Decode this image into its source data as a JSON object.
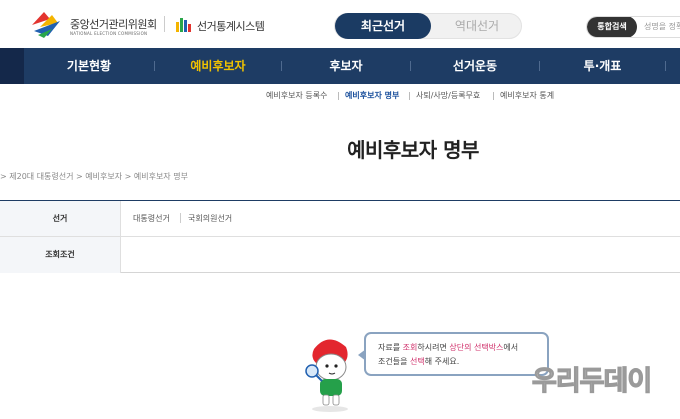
{
  "header": {
    "org_name": "중앙선거관리위원회",
    "org_english": "NATIONAL ELECTION COMMISSION",
    "system_name": "선거통계시스템",
    "toggle": {
      "active_label": "최근선거",
      "inactive_label": "역대선거"
    },
    "search": {
      "button_label": "통합검색",
      "placeholder": "성명을 정확"
    }
  },
  "gnb": {
    "items": [
      {
        "label": "기본현황"
      },
      {
        "label": "예비후보자"
      },
      {
        "label": "후보자"
      },
      {
        "label": "선거운동"
      },
      {
        "label": "투·개표"
      }
    ],
    "active_index": 1,
    "colors": {
      "bar": "#1e3c64",
      "active_text": "#f2c300"
    }
  },
  "subnav": {
    "items": [
      {
        "label": "예비후보자 등록수"
      },
      {
        "label": "예비후보자 명부"
      },
      {
        "label": "사퇴/사망/등록무효"
      },
      {
        "label": "예비후보자 통계"
      }
    ],
    "active_index": 1
  },
  "page": {
    "title": "예비후보자 명부",
    "breadcrumb": "> 제20대 대통령선거  >  예비후보자  >  예비후보자 명부"
  },
  "form": {
    "election_label": "선거",
    "election_options": [
      "대통령선거",
      "국회의원선거"
    ],
    "condition_label": "조회조건"
  },
  "guide": {
    "line1": {
      "p1": "자료를 ",
      "h1": "조회",
      "p2": "하시려면 ",
      "h2": "상단의 선택박스",
      "p3": "에서"
    },
    "line2": {
      "p1": "조건들을 ",
      "h1": "선택",
      "p2": "해 주세요."
    }
  },
  "watermark": {
    "text": "우리두데이"
  }
}
